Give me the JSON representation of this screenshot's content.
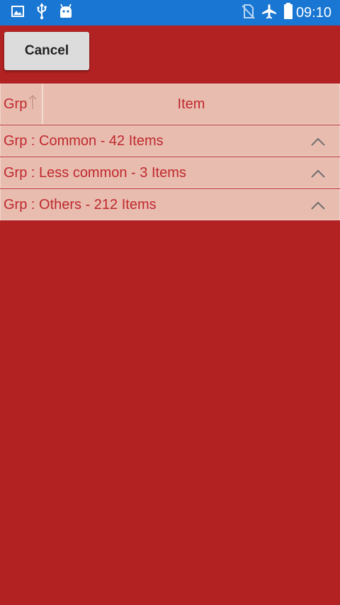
{
  "status_bar": {
    "time": "09:10",
    "left_icons": [
      "image-icon",
      "usb-icon",
      "android-icon"
    ],
    "right_icons": [
      "no-sim-icon",
      "airplane-icon",
      "battery-icon"
    ]
  },
  "toolbar": {
    "cancel_label": "Cancel"
  },
  "grid": {
    "columns": [
      {
        "label": "Grp",
        "sort": "ascending",
        "sort_icon": "sort-arrow-up-icon"
      },
      {
        "label": "Item"
      }
    ],
    "groups": [
      {
        "label": "Grp : Common - 42 Items",
        "icon": "chevron-up-icon"
      },
      {
        "label": "Grp : Less common - 3 Items",
        "icon": "chevron-up-icon"
      },
      {
        "label": "Grp : Others - 212 Items",
        "icon": "chevron-up-icon"
      }
    ]
  },
  "colors": {
    "background": "#b22222",
    "status_bar": "#1976d2",
    "row_background": "#e8bdb0",
    "text_accent": "#c0282d",
    "button": "#dcdcdc"
  }
}
